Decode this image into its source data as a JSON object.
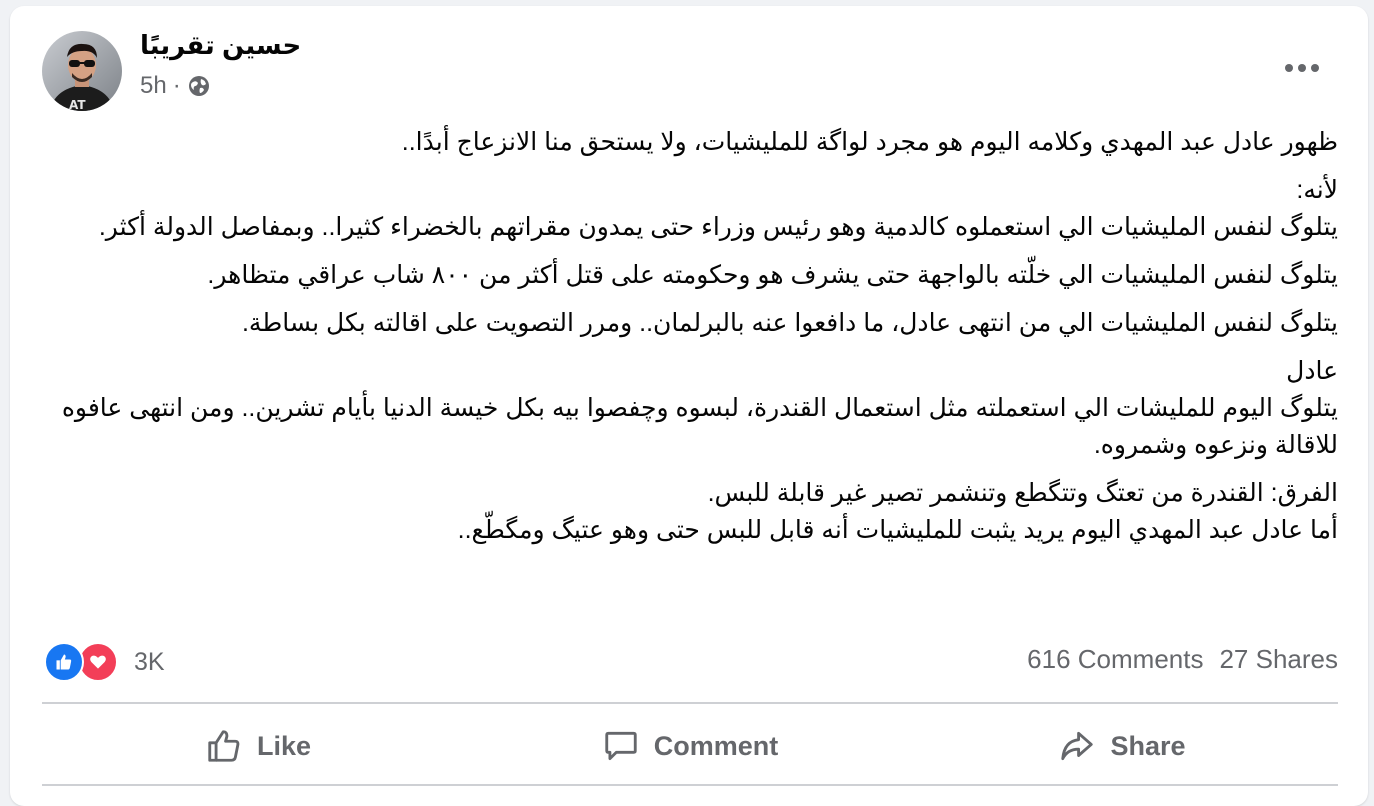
{
  "post": {
    "author": "حسين تقريبًا",
    "time": "5h",
    "separator": "·",
    "icons": {
      "privacy": "globe-icon",
      "more": "more-options-icon"
    },
    "paragraphs": [
      [
        "ظهور عادل عبد المهدي وكلامه اليوم هو مجرد لواگة للمليشيات، ولا يستحق منا الانزعاج أبدًا.."
      ],
      [
        "لأنه:",
        "يتلوگ لنفس المليشيات الي استعملوه كالدمية وهو رئيس وزراء حتى يمدون مقراتهم بالخضراء كثيرا.. وبمفاصل الدولة أكثر."
      ],
      [
        "يتلوگ لنفس المليشيات الي خلّته بالواجهة حتى يشرف هو وحكومته على قتل أكثر من ٨٠٠ شاب عراقي متظاهر."
      ],
      [
        "يتلوگ لنفس المليشيات الي من انتهى عادل، ما دافعوا عنه بالبرلمان.. ومرر التصويت على اقالته بكل بساطة."
      ],
      [
        "عادل",
        "يتلوگ اليوم للمليشات الي استعملته مثل استعمال القندرة، لبسوه وچفصوا بيه بكل خيسة الدنيا بأيام تشرين.. ومن انتهى عافوه للاقالة ونزعوه وشمروه."
      ],
      [
        "الفرق: القندرة من تعتگ وتتگطع وتنشمر تصير غير قابلة للبس.",
        "أما عادل عبد المهدي اليوم يريد يثبت للمليشيات أنه قابل للبس حتى وهو عتيگ ومگطّع.."
      ]
    ]
  },
  "engagement": {
    "reaction_icons": [
      "like-reaction-icon",
      "love-reaction-icon"
    ],
    "reactions_count": "3K",
    "comments": "616 Comments",
    "shares": "27 Shares"
  },
  "actions": {
    "like": "Like",
    "comment": "Comment",
    "share": "Share"
  },
  "colors": {
    "like_blue": "#1877f2",
    "love_red": "#f33e58",
    "secondary_text": "#65676b",
    "primary_text": "#050505"
  }
}
